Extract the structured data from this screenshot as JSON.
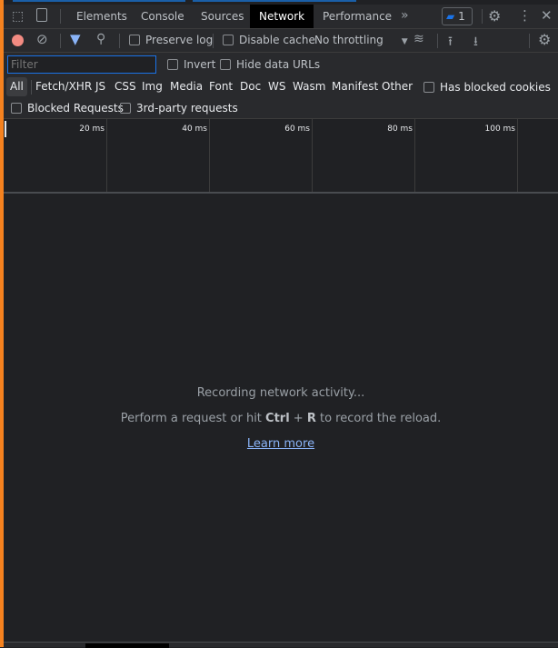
{
  "tabs": [
    {
      "label": "Elements"
    },
    {
      "label": "Console"
    },
    {
      "label": "Sources"
    },
    {
      "label": "Network",
      "active": true
    },
    {
      "label": "Performance"
    }
  ],
  "more_tabs": "»",
  "issues_count": "1",
  "toolbar": {
    "preserve_log": "Preserve log",
    "disable_cache": "Disable cache",
    "throttling": "No throttling"
  },
  "filter": {
    "placeholder": "Filter",
    "invert": "Invert",
    "hide_data_urls": "Hide data URLs"
  },
  "types": [
    "All",
    "Fetch/XHR",
    "JS",
    "CSS",
    "Img",
    "Media",
    "Font",
    "Doc",
    "WS",
    "Wasm",
    "Manifest",
    "Other"
  ],
  "has_blocked_cookies": "Has blocked cookies",
  "blocked_requests": "Blocked Requests",
  "third_party": "3rd-party requests",
  "timeline_ticks": [
    "20 ms",
    "40 ms",
    "60 ms",
    "80 ms",
    "100 ms"
  ],
  "empty": {
    "line1": "Recording network activity...",
    "line2_pre": "Perform a request or hit ",
    "key1": "Ctrl",
    "plus": " + ",
    "key2": "R",
    "line2_post": " to record the reload.",
    "learn_more": "Learn more"
  },
  "colors": {
    "accent": "#8ab4f8",
    "record": "#f28b82",
    "side": "#f5821f"
  }
}
